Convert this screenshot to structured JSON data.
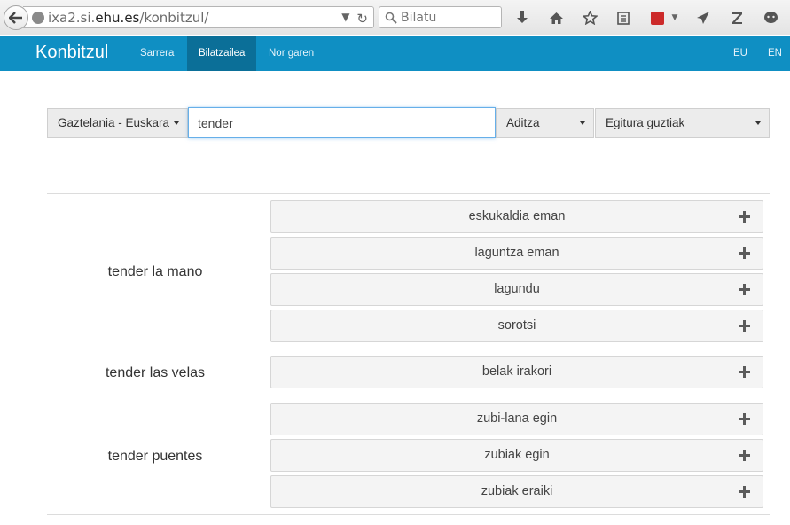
{
  "browser": {
    "url_prefix": "ixa2.si.",
    "url_host": "ehu.es",
    "url_path": "/konbitzul/",
    "search_placeholder": "Bilatu"
  },
  "navbar": {
    "brand": "Konbitzul",
    "items": [
      {
        "label": "Sarrera",
        "active": false
      },
      {
        "label": "Bilatzailea",
        "active": true
      },
      {
        "label": "Nor garen",
        "active": false
      }
    ],
    "languages": [
      "EU",
      "EN"
    ],
    "accent_color": "#0f8fc3"
  },
  "search": {
    "direction": "Gaztelania - Euskara",
    "term": "tender",
    "category": "Aditza",
    "structure": "Egitura guztiak"
  },
  "results": [
    {
      "phrase": "tender la mano",
      "translations": [
        "eskukaldia eman",
        "laguntza eman",
        "lagundu",
        "sorotsi"
      ]
    },
    {
      "phrase": "tender las velas",
      "translations": [
        "belak irakori"
      ]
    },
    {
      "phrase": "tender puentes",
      "translations": [
        "zubi-lana egin",
        "zubiak egin",
        "zubiak eraiki"
      ]
    }
  ]
}
